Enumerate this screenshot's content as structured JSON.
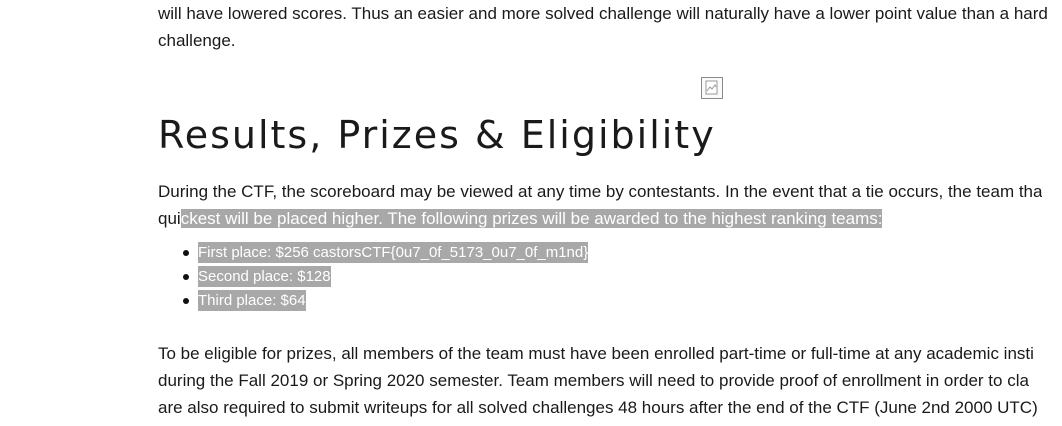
{
  "intro": {
    "line1": "will have lowered scores. Thus an easier and more solved challenge will naturally have a lower point value than a hard",
    "line2": "challenge."
  },
  "image": {
    "icon": "broken-image-icon"
  },
  "results": {
    "heading": "Results, Prizes & Eligibility",
    "line1": "During the CTF, the scoreboard may be viewed at any time by contestants. In the event that a tie occurs, the team tha",
    "line2_plain": "qui",
    "line2_selected": "ckest will be placed higher. The following prizes will be awarded to the highest ranking teams:"
  },
  "prizes": [
    {
      "label": "First place: $256 castorsCTF{0u7_0f_5173_0u7_0f_m1nd}"
    },
    {
      "label": "Second place: $128"
    },
    {
      "label": "Third place: $64"
    }
  ],
  "eligibility": {
    "line1": "To be eligible for prizes, all members of the team must have been enrolled part-time or full-time at any academic insti",
    "line2": "during the Fall 2019 or Spring 2020 semester. Team members will need to provide proof of enrollment in order to cla",
    "line3": "are also required to submit writeups for all solved challenges 48 hours after the end of the CTF (June 2nd 2000 UTC)"
  },
  "colors": {
    "selection": "#a8a8a8",
    "text": "#1a1a1a"
  }
}
